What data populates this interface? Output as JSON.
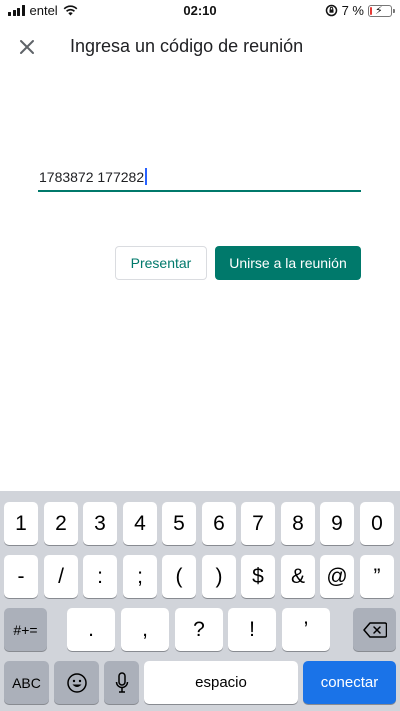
{
  "status_bar": {
    "carrier": "entel",
    "time": "02:10",
    "battery": "7 %",
    "battery_level": 0.07,
    "battery_color": "#e53935"
  },
  "header": {
    "title": "Ingresa un código de reunión",
    "close_icon": "close-icon"
  },
  "code_input": {
    "value": "1783872 177282"
  },
  "buttons": {
    "present": "Presentar",
    "join": "Unirse a la reunión"
  },
  "colors": {
    "accent": "#00796b",
    "caret": "#2962ff",
    "return_key": "#1a73e8"
  },
  "keyboard": {
    "row1": [
      "1",
      "2",
      "3",
      "4",
      "5",
      "6",
      "7",
      "8",
      "9",
      "0"
    ],
    "row2": [
      "-",
      "/",
      ":",
      ";",
      "(",
      ")",
      "$",
      "&",
      "@",
      "”"
    ],
    "row3": [
      ".",
      ",",
      "?",
      "!",
      "’"
    ],
    "symbols_key": "#+=",
    "abc_key": "ABC",
    "space": "espacio",
    "return": "conectar"
  }
}
